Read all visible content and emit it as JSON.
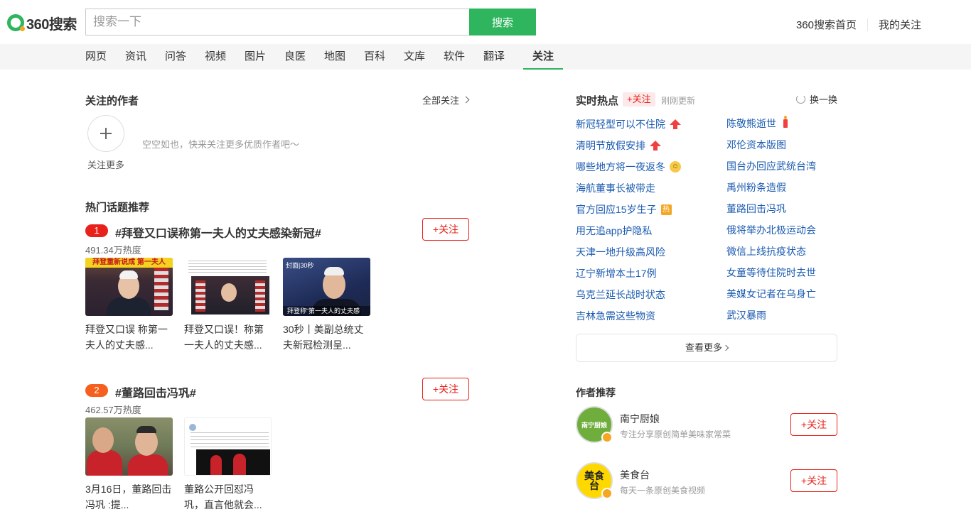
{
  "header": {
    "logo_text": "360搜索",
    "search_placeholder": "搜索一下",
    "search_button": "搜索",
    "links": [
      "360搜索首页",
      "我的关注"
    ]
  },
  "nav": {
    "tabs": [
      "网页",
      "资讯",
      "问答",
      "视频",
      "图片",
      "良医",
      "地图",
      "百科",
      "文库",
      "软件",
      "翻译",
      "关注"
    ],
    "active": "关注"
  },
  "followed_authors": {
    "title": "关注的作者",
    "all_link": "全部关注",
    "add_label": "关注更多",
    "empty_tip": "空空如也，快来关注更多优质作者吧～"
  },
  "hot_topics": {
    "title": "热门话题推荐",
    "items": [
      {
        "rank": "1",
        "title": "#拜登又口误称第一夫人的丈夫感染新冠#",
        "heat": "491.34万热度",
        "follow": "+关注",
        "thumbs": [
          {
            "caption": "拜登又口误 称第一夫人的丈夫感...",
            "banner": "拜登重新说成 第一夫人"
          },
          {
            "caption": "拜登又口误！称第一夫人的丈夫感..."
          },
          {
            "caption": "30秒丨美副总统丈夫新冠检测呈...",
            "tag": "封面|30秒",
            "overlay": "拜登称“第一夫人的丈夫感"
          }
        ]
      },
      {
        "rank": "2",
        "title": "#董路回击冯巩#",
        "heat": "462.57万热度",
        "follow": "+关注",
        "thumbs": [
          {
            "caption": "3月16日，董路回击冯巩 :提..."
          },
          {
            "caption": "董路公开回怼冯巩，直言他就会..."
          }
        ]
      }
    ]
  },
  "realtime_hot": {
    "title": "实时热点",
    "follow": "+关注",
    "updated": "刚刚更新",
    "refresh": "换一换",
    "left": [
      {
        "text": "新冠轻型可以不住院",
        "badge": "up"
      },
      {
        "text": "清明节放假安排",
        "badge": "up"
      },
      {
        "text": "哪些地方将一夜返冬",
        "badge": "emoji"
      },
      {
        "text": "海航董事长被带走",
        "badge": ""
      },
      {
        "text": "官方回应15岁生子",
        "badge": "hot",
        "badge_text": "热"
      },
      {
        "text": "用无追app护隐私",
        "badge": ""
      },
      {
        "text": "天津一地升级高风险",
        "badge": ""
      },
      {
        "text": "辽宁新增本土17例",
        "badge": ""
      },
      {
        "text": "乌克兰延长战时状态",
        "badge": ""
      },
      {
        "text": "吉林急需这些物资",
        "badge": ""
      }
    ],
    "right": [
      {
        "text": "陈敬熊逝世",
        "badge": "candle"
      },
      {
        "text": "邓伦资本版图",
        "badge": ""
      },
      {
        "text": "国台办回应武统台湾",
        "badge": ""
      },
      {
        "text": "禹州粉条造假",
        "badge": ""
      },
      {
        "text": "董路回击冯巩",
        "badge": ""
      },
      {
        "text": "俄将举办北极运动会",
        "badge": ""
      },
      {
        "text": "微信上线抗疫状态",
        "badge": ""
      },
      {
        "text": "女童等待住院时去世",
        "badge": ""
      },
      {
        "text": "美媒女记者在乌身亡",
        "badge": ""
      },
      {
        "text": "武汉暴雨",
        "badge": ""
      }
    ],
    "see_more": "查看更多"
  },
  "author_recommend": {
    "title": "作者推荐",
    "items": [
      {
        "name": "南宁厨娘",
        "desc": "专注分享原创简单美味家常菜",
        "follow": "+关注",
        "avatar_text": "南宁厨娘"
      },
      {
        "name": "美食台",
        "desc": "每天一条原创美食视频",
        "follow": "+关注",
        "avatar_text": "美食台"
      }
    ]
  },
  "colors": {
    "brand_green": "#2eb55d",
    "accent_red": "#e8211a",
    "link_blue": "#1a5ab0"
  }
}
